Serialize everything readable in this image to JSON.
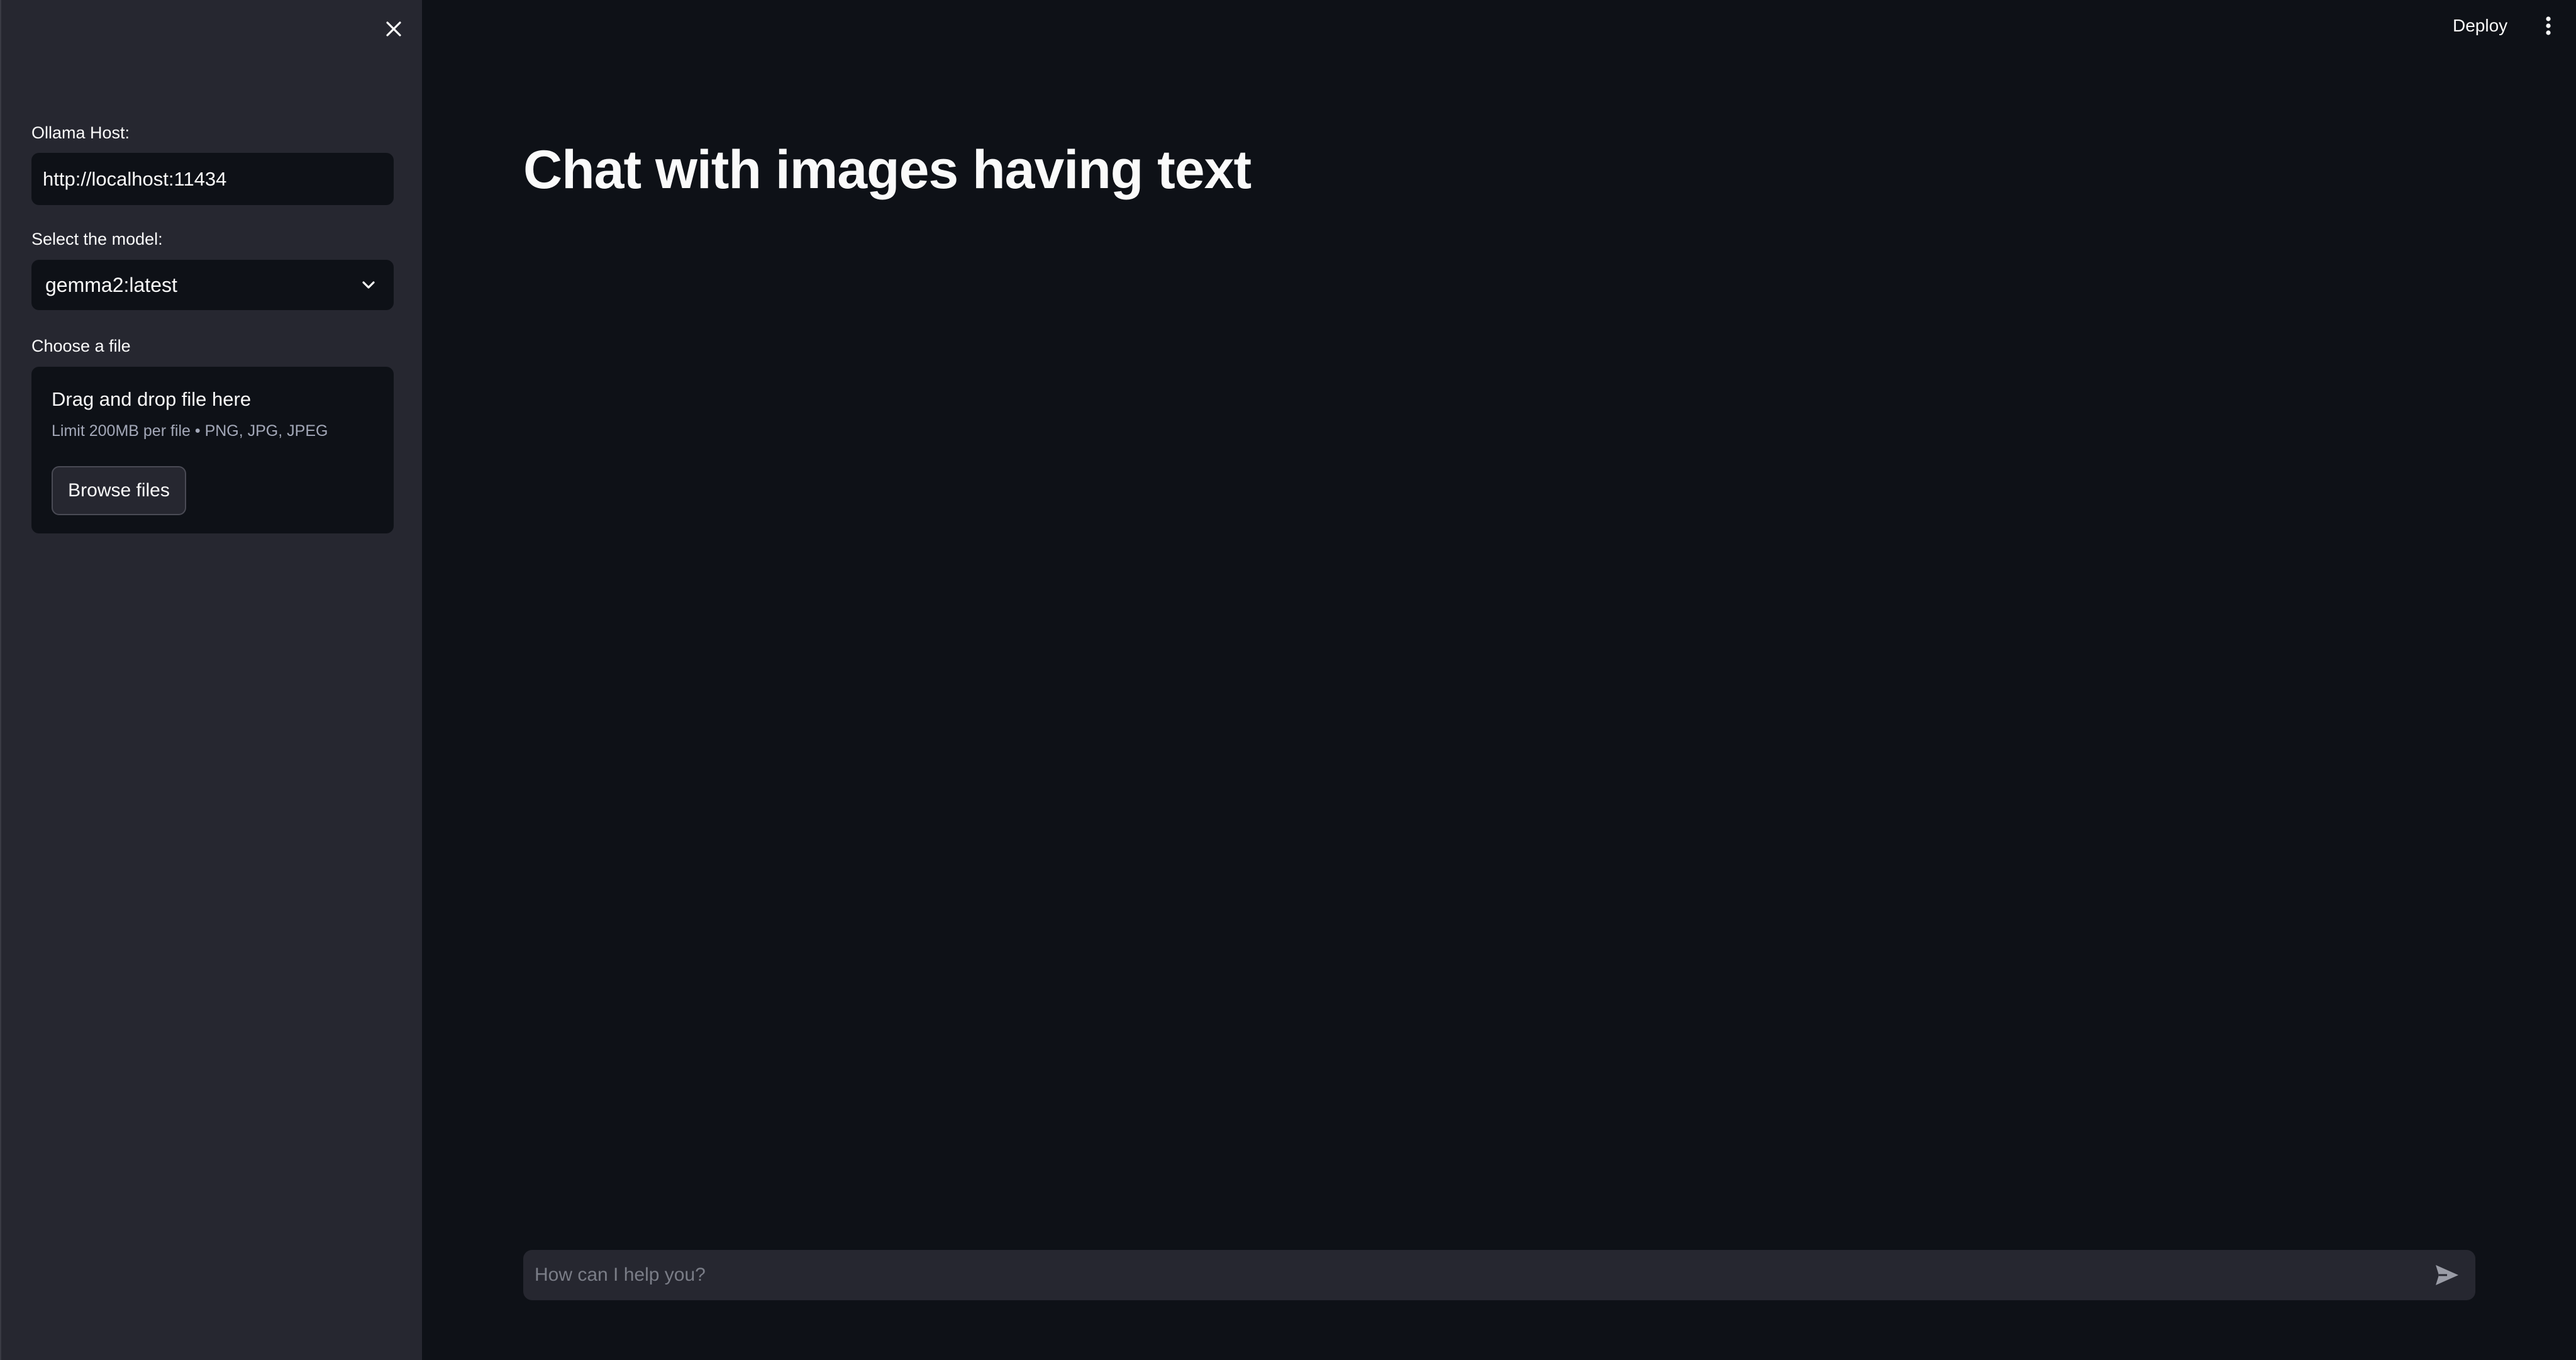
{
  "header": {
    "deploy_label": "Deploy",
    "menu_icon": "kebab-menu-icon"
  },
  "sidebar": {
    "close_icon": "close-icon",
    "host": {
      "label": "Ollama Host:",
      "value": "http://localhost:11434"
    },
    "model": {
      "label": "Select the model:",
      "selected": "gemma2:latest",
      "icon": "chevron-down-icon"
    },
    "file": {
      "label": "Choose a file",
      "dropzone_title": "Drag and drop file here",
      "dropzone_hint": "Limit 200MB per file • PNG, JPG, JPEG",
      "browse_label": "Browse files"
    }
  },
  "main": {
    "title": "Chat with images having text"
  },
  "chat": {
    "placeholder": "How can I help you?",
    "send_icon": "send-icon"
  },
  "colors": {
    "background": "#0e1117",
    "sidebar": "#262730",
    "text": "#fafafa",
    "muted": "#a3a8b8"
  }
}
